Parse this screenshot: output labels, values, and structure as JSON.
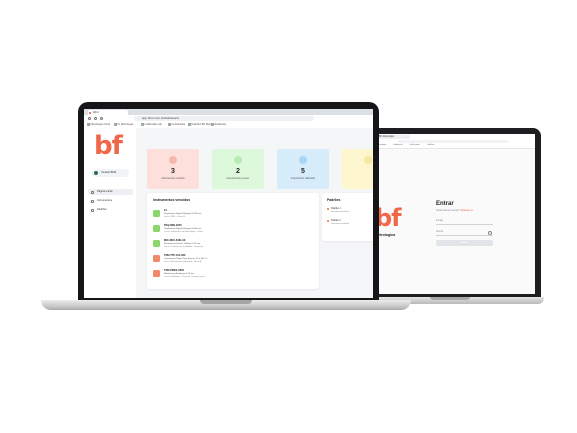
{
  "laptop1": {
    "browser": {
      "tab_title": "bfmt",
      "url": "app.bfmt.com.br/dashboard",
      "bookmarks": [
        "Metrologia Cloud",
        "IG Metrologia",
        "Calibração Lab",
        "Certificados",
        "Padrões BF Metro",
        "Relatórios"
      ]
    },
    "sidebar": {
      "logo": "bf",
      "user_name": "Usuário BFM",
      "nav": [
        {
          "label": "Página inicial",
          "active": true
        },
        {
          "label": "Instrumentos",
          "active": false
        },
        {
          "label": "Padrões",
          "active": false
        }
      ]
    },
    "cards": [
      {
        "value": "3",
        "label": "Instrumentos vencidos",
        "bg": "#fde0dc",
        "icon_bg": "#f7b7ad"
      },
      {
        "value": "2",
        "label": "Instrumentos a vencer",
        "bg": "#def8dc",
        "icon_bg": "#b5ecb0"
      },
      {
        "value": "5",
        "label": "Instrumentos calibrados",
        "bg": "#d7ecfb",
        "icon_bg": "#a7d5f6"
      },
      {
        "value": "",
        "label": "",
        "bg": "#fdf6cf",
        "icon_bg": "#f6e79b"
      }
    ],
    "instruments": {
      "title": "Instrumentos vencidos",
      "items": [
        {
          "title": "21",
          "line1": "Paquímetro Digital Mitutoyo 0-150 mm",
          "line2": "Local: PRD - Linha 02",
          "color": "#8ad86d"
        },
        {
          "title": "PAQ-MIN-3345",
          "line1": "Paquímetro Digital Mitutoyo 0-200 mm",
          "line2": "Local: Laboratório de Metrologia - Sala 1",
          "color": "#8ad86d"
        },
        {
          "title": "MIC-RES-6431-00",
          "line1": "Micrômetro Externo Tubular 0-25 mm",
          "line2": "Local: Controle de Qualidade - Inspeção",
          "color": "#8ad86d"
        },
        {
          "title": "TRN-TTP-101-002",
          "line1": "Termômetro Digital Tipo Espeto -50 a 300 °C",
          "line2": "Local: Manutenção Industrial - Setor B",
          "color": "#f08a6a"
        },
        {
          "title": "TRN-PRES-0332",
          "line1": "Manômetro Analógico 0-10 bar",
          "line2": "Local: Utilidades - Casa de Compressores",
          "color": "#f08a6a"
        }
      ]
    },
    "padroes": {
      "title": "Padrões",
      "items": [
        {
          "title": "Padrão 1",
          "sub": "Vencimento próximo"
        },
        {
          "title": "Padrão 2",
          "sub": "Vencimento próximo"
        }
      ]
    }
  },
  "laptop2": {
    "browser": {
      "tab_title": "BF Metrologia",
      "bookmarks": [
        "Metrologia",
        "Calibração",
        "Certificados",
        "Padrões"
      ]
    },
    "brand": "Metrologica",
    "login": {
      "title": "Entrar",
      "subtitle": "Ainda não tem conta?",
      "subtitle_link": "Cadastre-se",
      "email_placeholder": "E-mail",
      "password_placeholder": "Senha",
      "button": "Entrar"
    }
  }
}
